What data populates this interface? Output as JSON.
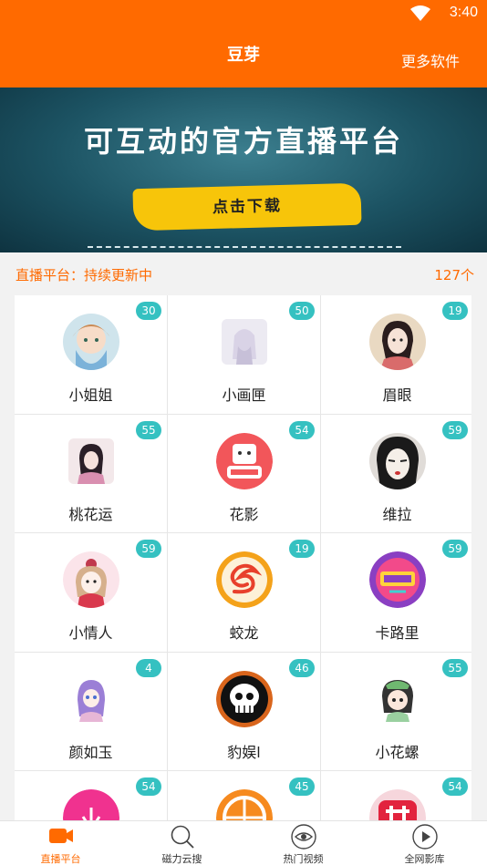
{
  "status_bar": {
    "time": "3:40"
  },
  "app_bar": {
    "title": "豆芽",
    "more_label": "更多软件"
  },
  "banner": {
    "headline": "可互动的官方直播平台",
    "button_label": "点击下载"
  },
  "section": {
    "label": "直播平台：持续更新中",
    "count": "127个"
  },
  "platforms": [
    {
      "name": "小姐姐",
      "badge": "30",
      "icon": "girl-avatar-icon"
    },
    {
      "name": "小画匣",
      "badge": "50",
      "icon": "painting-avatar-icon"
    },
    {
      "name": "眉眼",
      "badge": "19",
      "icon": "classical-lady-icon"
    },
    {
      "name": "桃花运",
      "badge": "55",
      "icon": "peach-blossom-girl-icon"
    },
    {
      "name": "花影",
      "badge": "54",
      "icon": "flower-shadow-logo-icon"
    },
    {
      "name": "维拉",
      "badge": "59",
      "icon": "opera-face-icon"
    },
    {
      "name": "小情人",
      "badge": "59",
      "icon": "cartoon-girl-icon"
    },
    {
      "name": "蛟龙",
      "badge": "19",
      "icon": "dragon-logo-icon"
    },
    {
      "name": "卡路里",
      "badge": "59",
      "icon": "kaluli-logo-icon"
    },
    {
      "name": "颜如玉",
      "badge": "4",
      "icon": "anime-girl-icon"
    },
    {
      "name": "豹娱l",
      "badge": "46",
      "icon": "skull-logo-icon"
    },
    {
      "name": "小花螺",
      "badge": "55",
      "icon": "chibi-girl-icon"
    },
    {
      "name": "",
      "badge": "54",
      "icon": "pink-logo-icon"
    },
    {
      "name": "",
      "badge": "45",
      "icon": "orange-logo-icon"
    },
    {
      "name": "",
      "badge": "54",
      "icon": "red-logo-icon"
    }
  ],
  "tabs": [
    {
      "label": "直播平台",
      "icon": "camera-icon",
      "active": true
    },
    {
      "label": "磁力云搜",
      "icon": "search-icon",
      "active": false
    },
    {
      "label": "热门视频",
      "icon": "eye-icon",
      "active": false
    },
    {
      "label": "全网影库",
      "icon": "play-icon",
      "active": false
    }
  ],
  "colors": {
    "accent": "#ff6a00",
    "badge": "#35c1c1",
    "banner_button": "#f7c50a"
  }
}
